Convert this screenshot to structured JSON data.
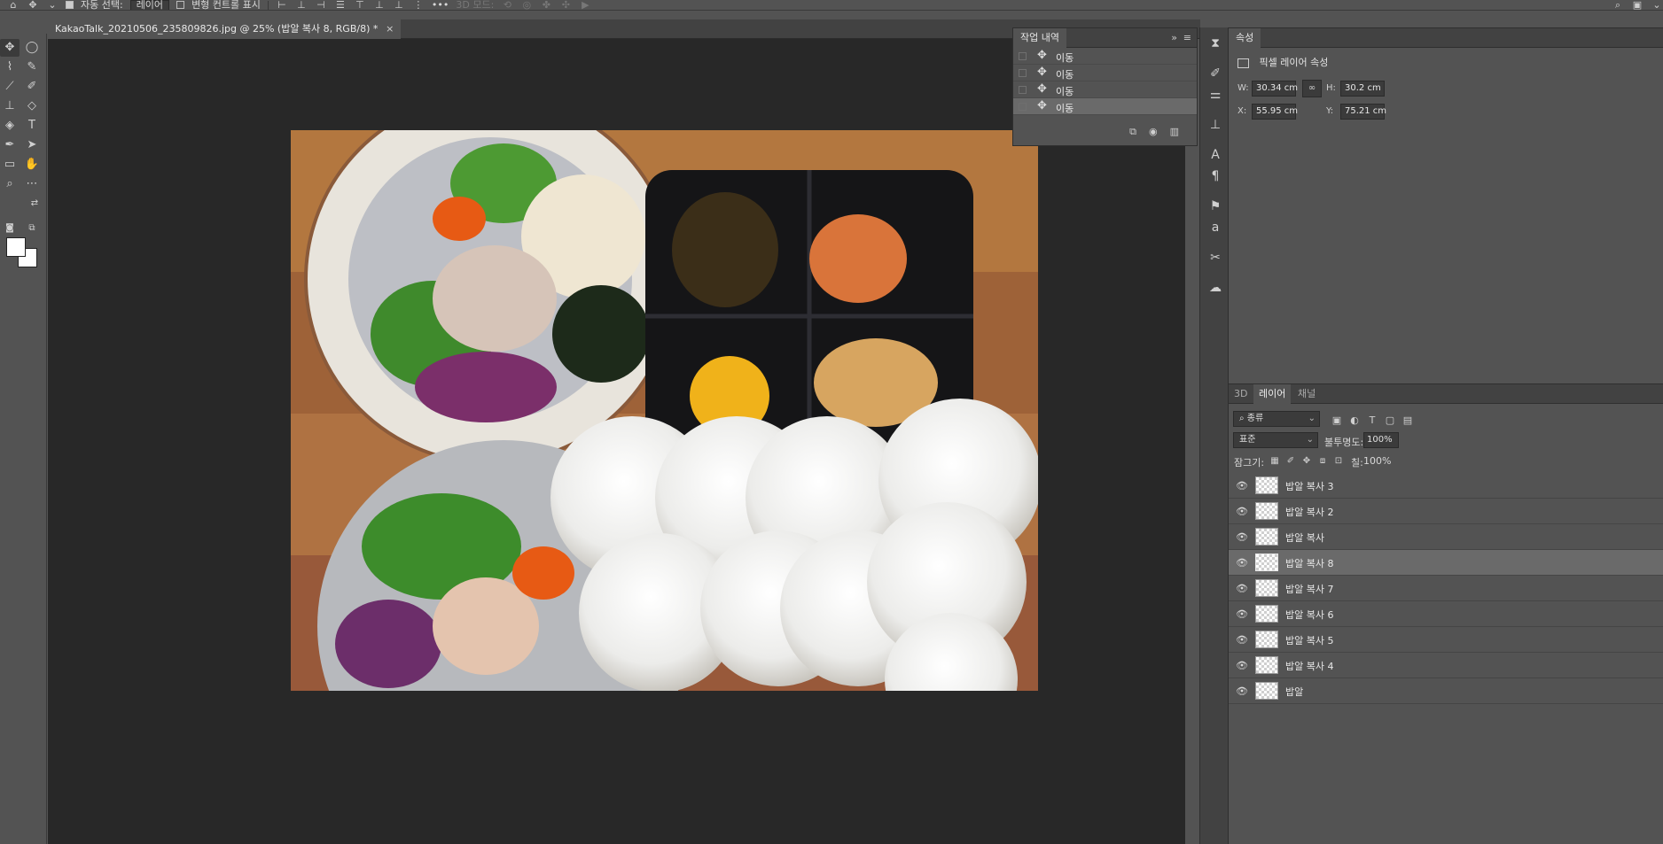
{
  "options_bar": {
    "auto_select_label": "자동 선택:",
    "auto_select_value": "레이어",
    "transform_controls_label": "변형 컨트롤 표시",
    "more_label": "•••",
    "mode_3d_label": "3D 모드:"
  },
  "document": {
    "tab_title": "KakaoTalk_20210506_235809826.jpg @ 25% (밥알 복사 8, RGB/8) *",
    "close_glyph": "×"
  },
  "history": {
    "tab": "작업 내역",
    "collapse_glyph": "»",
    "menu_glyph": "≡",
    "items": [
      {
        "label": "이동"
      },
      {
        "label": "이동"
      },
      {
        "label": "이동"
      },
      {
        "label": "이동",
        "selected": true
      }
    ]
  },
  "properties": {
    "tab": "속성",
    "subtitle": "픽셀 레이어 속성",
    "w_label": "W:",
    "w_value": "30.34 cm",
    "h_label": "H:",
    "h_value": "30.2 cm",
    "x_label": "X:",
    "x_value": "55.95 cm",
    "y_label": "Y:",
    "y_value": "75.21 cm"
  },
  "layers": {
    "tabs": [
      "3D",
      "레이어",
      "채널"
    ],
    "active_tab": "레이어",
    "filter_label": "종류",
    "blend_mode": "표준",
    "opacity_label": "불투명도:",
    "opacity_value": "100%",
    "lock_label": "잠그기:",
    "fill_label": "칠:",
    "fill_value": "100%",
    "items": [
      {
        "name": "밥알 복사 3",
        "visible": true
      },
      {
        "name": "밥알 복사 2",
        "visible": true
      },
      {
        "name": "밥알 복사",
        "visible": true
      },
      {
        "name": "밥알 복사 8",
        "visible": true,
        "selected": true
      },
      {
        "name": "밥알 복사 7",
        "visible": true
      },
      {
        "name": "밥알 복사 6",
        "visible": true
      },
      {
        "name": "밥알 복사 5",
        "visible": true
      },
      {
        "name": "밥알 복사 4",
        "visible": true
      },
      {
        "name": "밥알",
        "visible": true
      }
    ]
  },
  "colors": {
    "panel_bg": "#535353",
    "canvas_bg": "#282828",
    "selection_bg": "#6a6a6a"
  }
}
